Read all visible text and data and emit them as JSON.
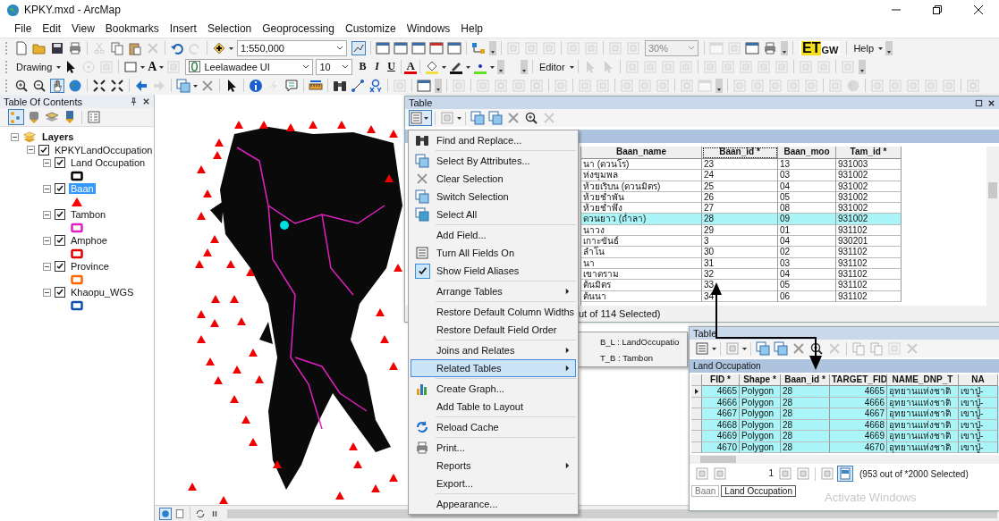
{
  "window": {
    "title": "KPKY.mxd - ArcMap"
  },
  "menu": [
    "File",
    "Edit",
    "View",
    "Bookmarks",
    "Insert",
    "Selection",
    "Geoprocessing",
    "Customize",
    "Windows",
    "Help"
  ],
  "toolbar": {
    "scale": "1:550,000",
    "drawing": "Drawing",
    "text_tool": "A",
    "font": "Leelawadee UI",
    "font_size": "10",
    "bold": "B",
    "italic": "I",
    "underline": "U",
    "font_color": "A",
    "layout_zoom": "30%",
    "logo": [
      "ET",
      "GW"
    ],
    "help": "Help",
    "editor": "Editor"
  },
  "toc": {
    "title": "Table Of Contents",
    "tree": [
      {
        "label": "Layers",
        "expanded": true,
        "children": [
          {
            "label": "KPKYLandOccupation",
            "expanded": true,
            "checked": true,
            "children": [
              {
                "label": "Land Occupation",
                "expanded": true,
                "checked": true,
                "selected": false,
                "kind": "polygon",
                "color": "#000000"
              },
              {
                "label": "Baan",
                "expanded": true,
                "checked": true,
                "selected": true,
                "kind": "marker",
                "color": "#ff0000"
              },
              {
                "label": "Tambon",
                "expanded": true,
                "checked": true,
                "selected": false,
                "kind": "polygon",
                "color": "#e020c0"
              },
              {
                "label": "Amphoe",
                "expanded": true,
                "checked": true,
                "selected": false,
                "kind": "polygon",
                "color": "#e00000"
              },
              {
                "label": "Province",
                "expanded": true,
                "checked": true,
                "selected": false,
                "kind": "polygon",
                "color": "#ff6600"
              },
              {
                "label": "Khaopu_WGS",
                "expanded": true,
                "checked": true,
                "selected": false,
                "kind": "polygon",
                "color": "#1050b0"
              }
            ]
          }
        ]
      }
    ]
  },
  "table": {
    "title": "Table",
    "columns": [
      "Baan_name",
      "Baan_id *",
      "Baan_moo",
      "Tam_id *"
    ],
    "rows": [
      {
        "cells": [
          "นา (ดวนโร)",
          "23",
          "13",
          "931003"
        ],
        "selected": false
      },
      {
        "cells": [
          "ห่งขุมพล",
          "24",
          "03",
          "931002"
        ],
        "selected": false
      },
      {
        "cells": [
          "ห้วยเริบน (ดวนมิตร)",
          "25",
          "04",
          "931002"
        ],
        "selected": false
      },
      {
        "cells": [
          "ห้วยช่ำพัน",
          "26",
          "05",
          "931002"
        ],
        "selected": false
      },
      {
        "cells": [
          "ห้วยช่ำพึง",
          "27",
          "08",
          "931002"
        ],
        "selected": false
      },
      {
        "cells": [
          "ดวนยาว (ถ่ำลา)",
          "28",
          "09",
          "931002"
        ],
        "selected": true
      },
      {
        "cells": [
          "นาวง",
          "29",
          "01",
          "931102"
        ],
        "selected": false
      },
      {
        "cells": [
          "เกาะขันธ์",
          "3",
          "04",
          "930201"
        ],
        "selected": false
      },
      {
        "cells": [
          "ลำโน",
          "30",
          "02",
          "931102"
        ],
        "selected": false
      },
      {
        "cells": [
          "นา",
          "31",
          "03",
          "931102"
        ],
        "selected": false
      },
      {
        "cells": [
          "เขาดราม",
          "32",
          "04",
          "931102"
        ],
        "selected": false
      },
      {
        "cells": [
          "ต้นมิตร",
          "33",
          "05",
          "931102"
        ],
        "selected": false
      },
      {
        "cells": [
          "ต้นนา",
          "34",
          "06",
          "931102"
        ],
        "selected": false
      }
    ],
    "status": "ut of 114 Selected)"
  },
  "context_menu": {
    "groups": [
      [
        {
          "label": "Find and Replace...",
          "submenu": false,
          "checked": false,
          "selected": false
        }
      ],
      [
        {
          "label": "Select By Attributes...",
          "submenu": false,
          "checked": false,
          "selected": false
        },
        {
          "label": "Clear Selection",
          "submenu": false,
          "checked": false,
          "selected": false
        },
        {
          "label": "Switch Selection",
          "submenu": false,
          "checked": false,
          "selected": false
        },
        {
          "label": "Select All",
          "submenu": false,
          "checked": false,
          "selected": false
        }
      ],
      [
        {
          "label": "Add Field...",
          "submenu": false,
          "checked": false,
          "selected": false
        },
        {
          "label": "Turn All Fields On",
          "submenu": false,
          "checked": false,
          "selected": false
        },
        {
          "label": "Show Field Aliases",
          "submenu": false,
          "checked": true,
          "selected": false
        }
      ],
      [
        {
          "label": "Arrange Tables",
          "submenu": true,
          "checked": false,
          "selected": false
        }
      ],
      [
        {
          "label": "Restore Default Column Widths",
          "submenu": false,
          "checked": false,
          "selected": false
        },
        {
          "label": "Restore Default Field Order",
          "submenu": false,
          "checked": false,
          "selected": false
        }
      ],
      [
        {
          "label": "Joins and Relates",
          "submenu": true,
          "checked": false,
          "selected": false
        },
        {
          "label": "Related Tables",
          "submenu": true,
          "checked": false,
          "selected": true
        }
      ],
      [
        {
          "label": "Create Graph...",
          "submenu": false,
          "checked": false,
          "selected": false
        },
        {
          "label": "Add Table to Layout",
          "submenu": false,
          "checked": false,
          "selected": false
        }
      ],
      [
        {
          "label": "Reload Cache",
          "submenu": false,
          "checked": false,
          "selected": false
        }
      ],
      [
        {
          "label": "Print...",
          "submenu": false,
          "checked": false,
          "selected": false
        },
        {
          "label": "Reports",
          "submenu": true,
          "checked": false,
          "selected": false
        },
        {
          "label": "Export...",
          "submenu": false,
          "checked": false,
          "selected": false
        }
      ],
      [
        {
          "label": "Appearance...",
          "submenu": false,
          "checked": false,
          "selected": false
        }
      ]
    ]
  },
  "submenu": [
    "B_L : LandOccupatio",
    "T_B : Tambon"
  ],
  "related_table": {
    "title": "Table",
    "layer": "Land Occupation",
    "columns": [
      "FID *",
      "Shape *",
      "Baan_id *",
      "TARGET_FID",
      "NAME_DNP_T",
      "NA"
    ],
    "rows": [
      {
        "cells": [
          "4665",
          "Polygon",
          "28",
          "4665",
          "อุทยานแห่งชาติ",
          "เขาปู่-"
        ],
        "selected": true,
        "current": true
      },
      {
        "cells": [
          "4666",
          "Polygon",
          "28",
          "4666",
          "อุทยานแห่งชาติ",
          "เขาปู่-"
        ],
        "selected": true,
        "current": false
      },
      {
        "cells": [
          "4667",
          "Polygon",
          "28",
          "4667",
          "อุทยานแห่งชาติ",
          "เขาปู่-"
        ],
        "selected": true,
        "current": false
      },
      {
        "cells": [
          "4668",
          "Polygon",
          "28",
          "4668",
          "อุทยานแห่งชาติ",
          "เขาปู่-"
        ],
        "selected": true,
        "current": false
      },
      {
        "cells": [
          "4669",
          "Polygon",
          "28",
          "4669",
          "อุทยานแห่งชาติ",
          "เขาปู่-"
        ],
        "selected": true,
        "current": false
      },
      {
        "cells": [
          "4670",
          "Polygon",
          "28",
          "4670",
          "อุทยานแห่งชาติ",
          "เขาปู่-"
        ],
        "selected": true,
        "current": false
      }
    ],
    "record": "1",
    "status": "(953 out of *2000 Selected)",
    "tabs": [
      {
        "label": "Baan",
        "selected": false
      },
      {
        "label": "Land Occupation",
        "selected": true
      }
    ]
  },
  "overlay_text": "Activate Windows"
}
